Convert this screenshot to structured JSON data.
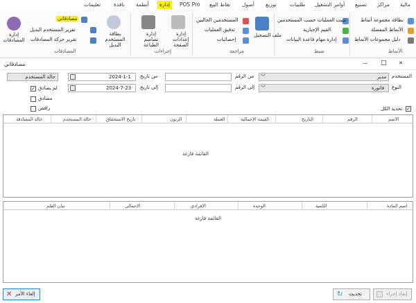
{
  "menu": [
    "مالية",
    "مراكز",
    "تصنيع",
    "أوامر التشغيل",
    "طلبيات",
    "توزيع",
    "أصول",
    "نقاط البيع",
    "POS Pro",
    "إدارة",
    "أنظمة",
    "نافذة",
    "تعليمات"
  ],
  "menu_active": "إدارة",
  "ribbon": {
    "groups": {
      "left_titles": {
        "approvals": "المصادقات",
        "actions": "إجراءات",
        "review": "مراجعة",
        "control": "ضبط",
        "sets": "الأنماط"
      },
      "approvals": {
        "manage": "إدارة المصادقات",
        "my_approvals": "مصادقاتي",
        "replacement_report": "تقرير المستخدم البديل",
        "movement_report": "تقرير حركة المصادقات",
        "replacement_card": "بطاقة المستخدم البديل"
      },
      "actions": {
        "print_designs": "إدارة تصاميم الطباعة",
        "page_settings": "إدارة إعدادات الصفحة"
      },
      "review": {
        "current_users": "المستخدمين الحاليين",
        "audit_ops": "تدقيق العمليات",
        "stats": "إحصائيات",
        "log_file": "ملف التسجيل"
      },
      "control": {
        "fix_ops": "تثبيت العمليات حسب المستخدمين",
        "default_values": "القيم الإجبارية",
        "db_tasks": "إدارة مهام قاعدة البيانات"
      },
      "sets": {
        "set_card": "بطاقة مجموعة أنماط",
        "fav_sets": "الأنماط المفضلة",
        "sets_guide": "دليل مجموعات الأنماط"
      }
    }
  },
  "window": {
    "title": "مصادقاتي",
    "min": "—",
    "max": "□",
    "close": "✕"
  },
  "form": {
    "user_label": "المستخدم",
    "user_value": "مدير",
    "type_label": "النوع",
    "type_value": "فاتورة",
    "from_num_label": "من الرقم",
    "to_num_label": "إلى الرقم",
    "from_date_label": "من تاريخ",
    "from_date_value": "2024-1-1",
    "to_date_label": "إلى تاريخ",
    "to_date_value": "2024-7-23",
    "user_status": "حالة المستخدم",
    "not_approved": "لم يصادق",
    "approved": "مصادق",
    "rejected": "رافض",
    "select_all": "تحديد الكل"
  },
  "grid1": {
    "columns": [
      "الاسم",
      "الرقم",
      "التاريخ",
      "القيمة الإجمالية",
      "العملة",
      "الزبون",
      "تاريخ الاستحقاق",
      "حالة المستخدم",
      "حالة المصادقة"
    ],
    "empty": "القائمة فارغة"
  },
  "grid2": {
    "columns": [
      "اسم المادة",
      "الكمية",
      "الوحدة",
      "الإفرادي",
      "الإجمالي",
      "بيان القلم"
    ],
    "empty": "القائمة فارغة"
  },
  "buttons": {
    "execute": "إنفاذ إجراء",
    "refresh": "تحديث",
    "cancel": "إلغاء الأمر"
  },
  "colors": {
    "highlight": "#f8f400",
    "accent": "#1e88e5"
  }
}
